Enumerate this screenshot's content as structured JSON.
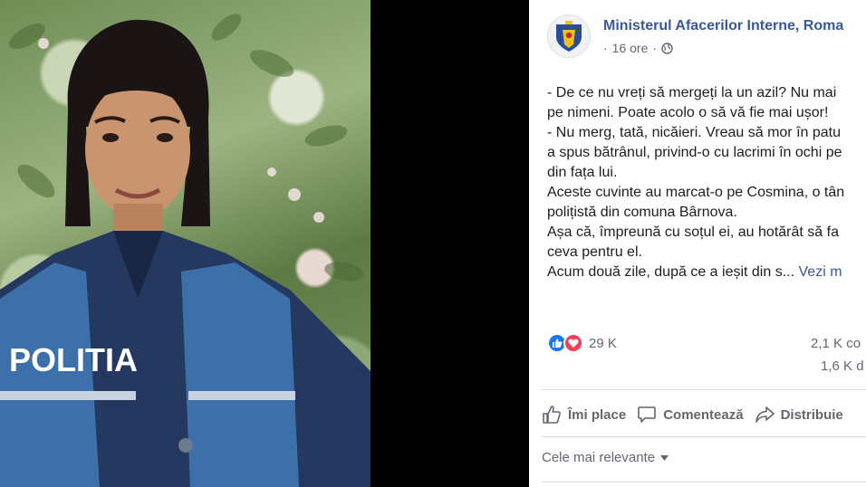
{
  "post": {
    "page_name": "Ministerul Afacerilor Interne, Roma",
    "timestamp": "16 ore",
    "privacy_icon": "globe-icon",
    "text_lines": [
      "- De ce nu vreți să mergeți la un azil? Nu mai",
      "pe nimeni. Poate acolo o să vă fie mai ușor!",
      "- Nu merg, tată, nicăieri. Vreau să mor în patu",
      "a spus bătrânul, privind-o cu lacrimi în ochi pe",
      "din fața lui.",
      "Aceste cuvinte au marcat-o pe Cosmina, o tân",
      "polițistă din comuna Bârnova.",
      "Așa că, împreună cu soțul ei, au hotărât să fa",
      "ceva pentru el."
    ],
    "last_line": "Acum două zile, după ce a ieșit din s...",
    "see_more": "Vezi m",
    "reaction_count": "29 K",
    "comments_count": "2,1 K co",
    "shares_count": "1,6 K d",
    "actions": {
      "like": "Îmi place",
      "comment": "Comentează",
      "share": "Distribuie"
    },
    "comment_filter": "Cele mai relevante",
    "colors": {
      "link": "#385898",
      "like": "#1877f2",
      "love": "#f33e58"
    }
  },
  "photo": {
    "vest_text": "POLITIA"
  }
}
